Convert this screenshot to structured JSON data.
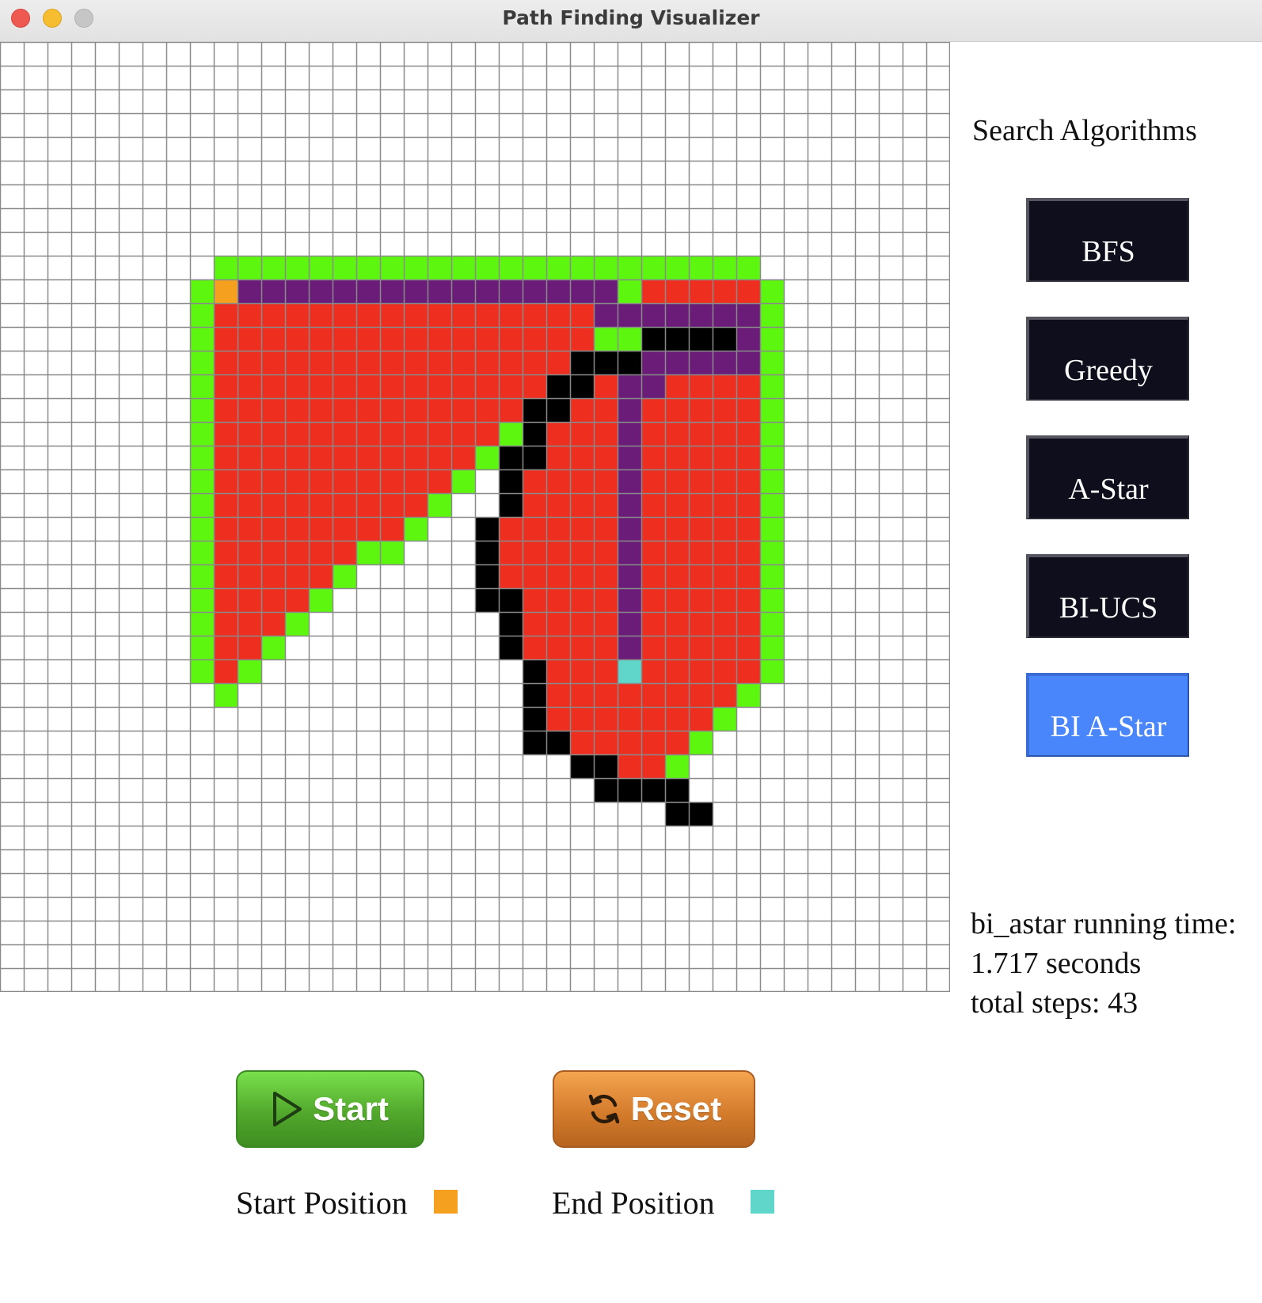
{
  "window": {
    "title": "Path Finding Visualizer"
  },
  "sidebar": {
    "heading": "Search Algorithms",
    "algorithms": [
      {
        "label": "BFS",
        "active": false
      },
      {
        "label": "Greedy",
        "active": false
      },
      {
        "label": "A-Star",
        "active": false
      },
      {
        "label": "BI-UCS",
        "active": false
      },
      {
        "label": "BI A-Star",
        "active": true
      }
    ]
  },
  "stats": {
    "running_time_label": "bi_astar running time:",
    "running_time_value": "1.717 seconds",
    "total_steps": "total steps: 43"
  },
  "controls": {
    "start_label": "Start",
    "reset_label": "Reset"
  },
  "legend": {
    "start_label": "Start Position",
    "end_label": "End Position",
    "start_color": "#f5a11f",
    "end_color": "#5fd6c9"
  },
  "colors": {
    "empty": "#ffffff",
    "grid_line": "#8a8a8a",
    "visited": "#ee2e1f",
    "frontier": "#5df60f",
    "wall": "#000000",
    "path": "#6b1c78",
    "start": "#f5a11f",
    "end": "#5fd6c9",
    "active_button": "#4a86fb",
    "algo_button": "#0e0e1c",
    "start_button": "#52a82c",
    "reset_button": "#d47c2c"
  },
  "grid": {
    "rows": 40,
    "cols": 40,
    "legend": {
      ".": "empty",
      "R": "visited",
      "G": "frontier",
      "B": "wall",
      "P": "path",
      "S": "start",
      "E": "end"
    },
    "cells": [
      "........................................",
      "........................................",
      "........................................",
      "........................................",
      "........................................",
      "........................................",
      "........................................",
      "........................................",
      "........................................",
      ".........GGGGGGGGGGGGGGGGGGGGGGG........",
      "........GSPPPPPPPPPPPPPPPPGRRRRRG.......",
      "........GRRRRRRRRRRRRRRRRPPPPPPPG.......",
      "........GRRRRRRRRRRRRRRRRGGBBBBPG.......",
      "........GRRRRRRRRRRRRRRRBBBPPPPPG.......",
      "........GRRRRRRRRRRRRRRBBRPPRRRRG.......",
      "........GRRRRRRRRRRRRRBBRRPRRRRRG.......",
      "........GRRRRRRRRRRRRGBRRRPRRRRRG.......",
      "........GRRRRRRRRRRRGBBRRRPRRRRRG.......",
      "........GRRRRRRRRRRG.BRRRRPRRRRRG.......",
      "........GRRRRRRRRRG..BRRRRPRRRRRG.......",
      "........GRRRRRRRRG..BRRRRRPRRRRRG.......",
      "........GRRRRRRGG...BRRRRRPRRRRRG.......",
      "........GRRRRRG.....BRRRRRPRRRRRG.......",
      "........GRRRRG......BBRRRRPRRRRRG.......",
      "........GRRRG........BRRRRPRRRRRG.......",
      "........GRRG.........BRRRRPRRRRRG.......",
      "........GRG...........BRRRERRRRRG.......",
      ".........G............BRRRRRRRRG........",
      "......................BRRRRRRRG.........",
      "......................BBRRRRRG..........",
      "........................BBRRG...........",
      ".........................BBBB...........",
      "............................BB..........",
      "........................................",
      "........................................",
      "........................................",
      "........................................",
      "........................................",
      "........................................",
      "........................................"
    ]
  }
}
